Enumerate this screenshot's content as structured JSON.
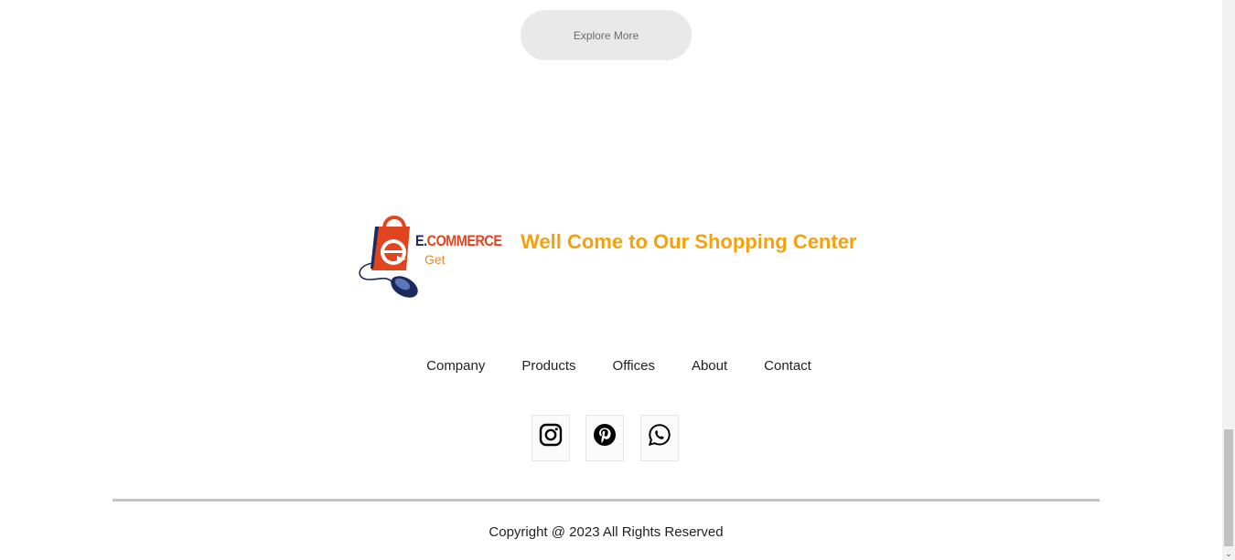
{
  "explore": {
    "label": "Explore More"
  },
  "brand": {
    "name_prefix": "E.",
    "name_main": "COMMERCE",
    "sub": "Get",
    "colors": {
      "navy": "#1c2a5c",
      "orange": "#e0451f",
      "light_orange": "#e58a3a"
    }
  },
  "tagline": "Well Come to Our Shopping Center",
  "footer_nav": {
    "items": [
      {
        "label": "Company"
      },
      {
        "label": "Products"
      },
      {
        "label": "Offices"
      },
      {
        "label": "About"
      },
      {
        "label": "Contact"
      }
    ]
  },
  "social": {
    "icons": [
      "instagram-icon",
      "pinterest-icon",
      "whatsapp-icon"
    ]
  },
  "copyright": "Copyright @ 2023 All Rights Reserved",
  "colors": {
    "accent": "#f6a10c",
    "button_bg": "#e9e9e9",
    "divider": "#c2c2c2"
  }
}
